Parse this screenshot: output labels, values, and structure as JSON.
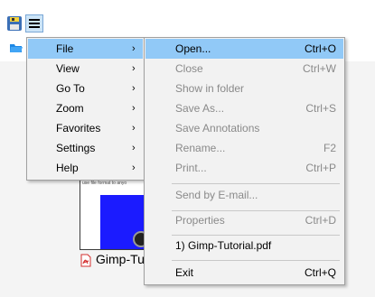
{
  "main_menu": {
    "items": [
      {
        "label": "File"
      },
      {
        "label": "View"
      },
      {
        "label": "Go To"
      },
      {
        "label": "Zoom"
      },
      {
        "label": "Favorites"
      },
      {
        "label": "Settings"
      },
      {
        "label": "Help"
      }
    ],
    "arrow": "›"
  },
  "file_menu": {
    "items": [
      {
        "label": "Open...",
        "shortcut": "Ctrl+O",
        "enabled": true
      },
      {
        "label": "Close",
        "shortcut": "Ctrl+W",
        "enabled": false
      },
      {
        "label": "Show in folder",
        "shortcut": "",
        "enabled": false
      },
      {
        "label": "Save As...",
        "shortcut": "Ctrl+S",
        "enabled": false
      },
      {
        "label": "Save Annotations",
        "shortcut": "",
        "enabled": false
      },
      {
        "label": "Rename...",
        "shortcut": "F2",
        "enabled": false
      },
      {
        "label": "Print...",
        "shortcut": "Ctrl+P",
        "enabled": false
      },
      {
        "label": "Send by E-mail...",
        "shortcut": "",
        "enabled": false
      },
      {
        "label": "Properties",
        "shortcut": "Ctrl+D",
        "enabled": false
      },
      {
        "label": "1) Gimp-Tutorial.pdf",
        "shortcut": "",
        "enabled": true
      },
      {
        "label": "Exit",
        "shortcut": "Ctrl+Q",
        "enabled": true
      }
    ]
  },
  "document": {
    "thumbnail_caption": "Gimp-Tu",
    "thumbnail_text": "use file format to anyo"
  },
  "colors": {
    "highlight": "#91c9f7",
    "menu_bg": "#f2f2f2",
    "disabled_text": "#8a8a8a"
  },
  "icons": {
    "app": "floppy-app-icon",
    "menu": "hamburger-menu-icon",
    "folder": "folder-open-icon",
    "pdf": "pdf-file-icon"
  }
}
